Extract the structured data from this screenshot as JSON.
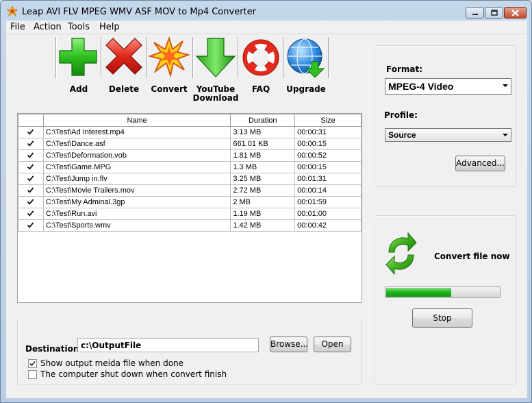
{
  "window": {
    "title": "Leap AVI FLV MPEG WMV ASF MOV to Mp4 Converter"
  },
  "menu": [
    "File",
    "Action",
    "Tools",
    "Help"
  ],
  "toolbar": [
    {
      "label": "Add",
      "icon": "plus-icon"
    },
    {
      "label": "Delete",
      "icon": "x-icon"
    },
    {
      "label": "Convert",
      "icon": "burst-icon"
    },
    {
      "label": "YouTube Download",
      "icon": "down-arrow-icon"
    },
    {
      "label": "FAQ",
      "icon": "lifebuoy-icon"
    },
    {
      "label": "Upgrade",
      "icon": "globe-download-icon"
    }
  ],
  "table": {
    "headers": [
      "Name",
      "Duration",
      "Size"
    ],
    "rows": [
      {
        "checked": true,
        "name": "C:\\Test\\Ad Interest.mp4",
        "duration": "3.13 MB",
        "size": "00:00:31"
      },
      {
        "checked": true,
        "name": "C:\\Test\\Dance.asf",
        "duration": "661.01 KB",
        "size": "00:00:15"
      },
      {
        "checked": true,
        "name": "C:\\Test\\Deformation.vob",
        "duration": "1.81 MB",
        "size": "00:00:52"
      },
      {
        "checked": true,
        "name": "C:\\Test\\Game.MPG",
        "duration": "1.3 MB",
        "size": "00:00:15"
      },
      {
        "checked": true,
        "name": "C:\\Test\\Jump in.flv",
        "duration": "3.25 MB",
        "size": "00:01:31"
      },
      {
        "checked": true,
        "name": "C:\\Test\\Movie Trailers.mov",
        "duration": "2.72 MB",
        "size": "00:00:14"
      },
      {
        "checked": true,
        "name": "C:\\Test\\My Adminal.3gp",
        "duration": "2 MB",
        "size": "00:01:59"
      },
      {
        "checked": true,
        "name": "C:\\Test\\Run.avi",
        "duration": "1.19 MB",
        "size": "00:01:00"
      },
      {
        "checked": true,
        "name": "C:\\Test\\Sports.wmv",
        "duration": "1.42 MB",
        "size": "00:00:42"
      }
    ]
  },
  "output": {
    "destination_label": "Destination:",
    "destination_value": "c:\\OutputFile",
    "browse_label": "Browse...",
    "open_label": "Open",
    "show_output": {
      "checked": true,
      "label": "Show output meida file when done"
    },
    "shutdown": {
      "checked": false,
      "label": "The computer shut down when convert finish"
    }
  },
  "settings": {
    "format_label": "Format:",
    "format_value": "MPEG-4 Video",
    "profile_label": "Profile:",
    "profile_value": "Source",
    "advanced_label": "Advanced..."
  },
  "convert": {
    "status_text": "Convert file now",
    "progress": 0.57,
    "stop_label": "Stop",
    "icon": "refresh-icon"
  },
  "colors": {
    "accent_green": "#23b11f",
    "delete_red": "#d9261c",
    "title_bar": "#c5d7ea"
  }
}
